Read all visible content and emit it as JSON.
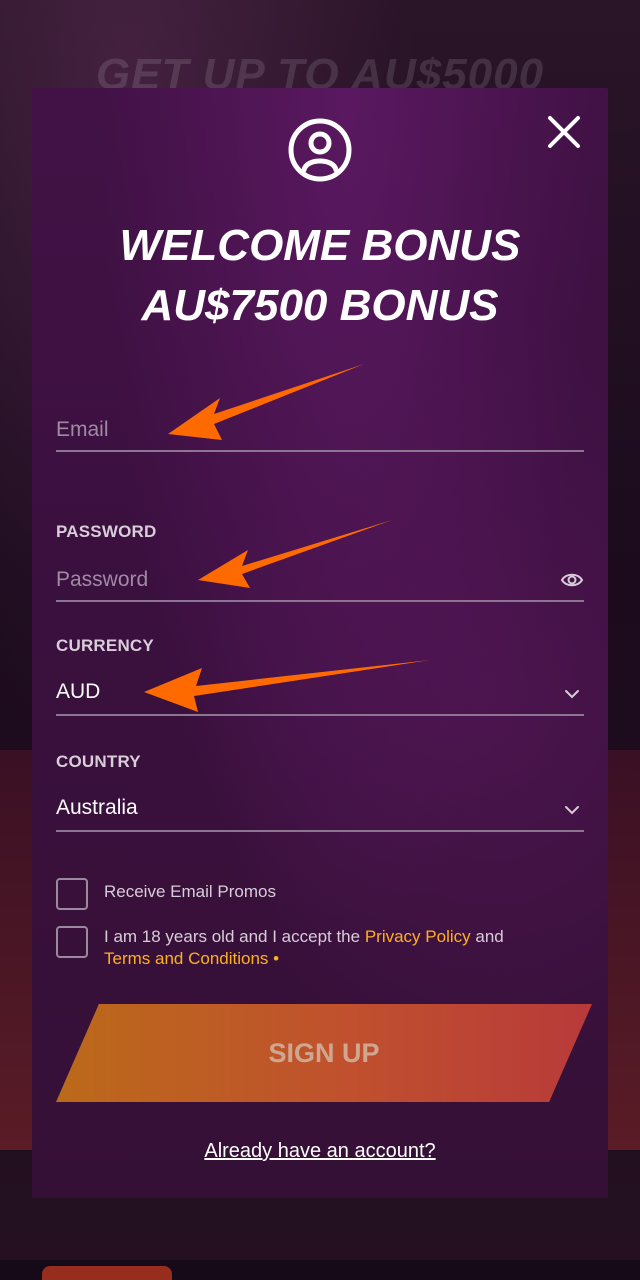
{
  "background": {
    "heading": "GET UP TO AU$5000"
  },
  "modal": {
    "title_line1": "WELCOME BONUS",
    "title_line2": "AU$7500 BONUS",
    "close_icon": "close-icon",
    "avatar_icon": "user-circle-icon"
  },
  "form": {
    "email": {
      "placeholder": "Email",
      "value": ""
    },
    "password": {
      "label": "PASSWORD",
      "placeholder": "Password",
      "value": "",
      "toggle_icon": "eye-icon"
    },
    "currency": {
      "label": "CURRENCY",
      "value": "AUD",
      "icon": "chevron-down-icon"
    },
    "country": {
      "label": "COUNTRY",
      "value": "Australia",
      "icon": "chevron-down-icon"
    },
    "promos_label": "Receive Email Promos",
    "terms": {
      "prefix": "I am 18 years old and I accept the ",
      "privacy_link": "Privacy Policy",
      "middle": " and",
      "terms_link": "Terms and Conditions",
      "required_mark": " •"
    },
    "signup_label": "SIGN UP",
    "login_link": "Already have an account?"
  },
  "annotations": {
    "arrow_color": "#ff6a00"
  },
  "colors": {
    "accent": "#ffb01f",
    "modal_bg": "#3b103f"
  }
}
